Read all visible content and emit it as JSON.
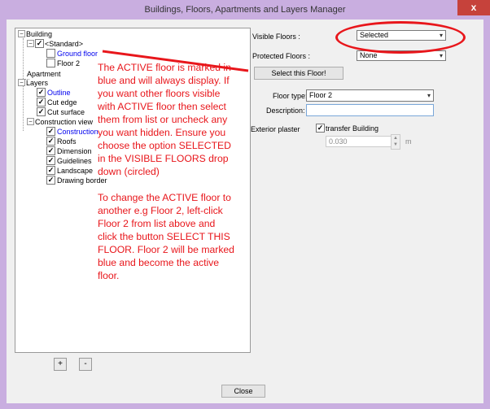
{
  "window": {
    "title": "Buildings, Floors, Apartments and Layers Manager",
    "close_glyph": "x"
  },
  "tree": {
    "building": "Building",
    "standard": "<Standard>",
    "ground_floor": "Ground floor",
    "floor2": "Floor 2",
    "apartment": "Apartment",
    "layers": "Layers",
    "outline": "Outline",
    "cut_edge": "Cut edge",
    "cut_surface": "Cut surface",
    "construction_view": "Construction view",
    "construction": "Construction",
    "roofs": "Roofs",
    "dimension": "Dimension",
    "guidelines": "Guidelines",
    "landscape": "Landscape",
    "drawing_border": "Drawing border"
  },
  "annotation": {
    "para1": "The ACTIVE floor is marked in blue and will always display. If you want other floors visible with ACTIVE floor then select them from list or uncheck any you want hidden. Ensure you choose the option SELECTED in the VISIBLE FLOORS drop down (circled)",
    "para2": "To change the ACTIVE floor to another e.g Floor 2, left-click Floor 2 from list above and click the button SELECT THIS FLOOR. Floor 2 will be marked blue and become the active floor."
  },
  "buttons": {
    "add": "+",
    "remove": "-",
    "select_floor": "Select this Floor!",
    "close": "Close"
  },
  "form": {
    "visible_floors_label": "Visible Floors :",
    "visible_floors_value": "Selected",
    "protected_floors_label": "Protected Floors :",
    "protected_floors_value": "None",
    "floor_type_label": "Floor type:",
    "floor_type_value": "Floor 2",
    "description_label": "Description:",
    "description_value": "",
    "exterior_plaster_label": "Exterior plaster",
    "transfer_building_label": "transfer Building",
    "plaster_value": "0.030",
    "plaster_unit": "m"
  },
  "colors": {
    "annotation": "#e8161b",
    "active_floor": "#0000ee"
  }
}
